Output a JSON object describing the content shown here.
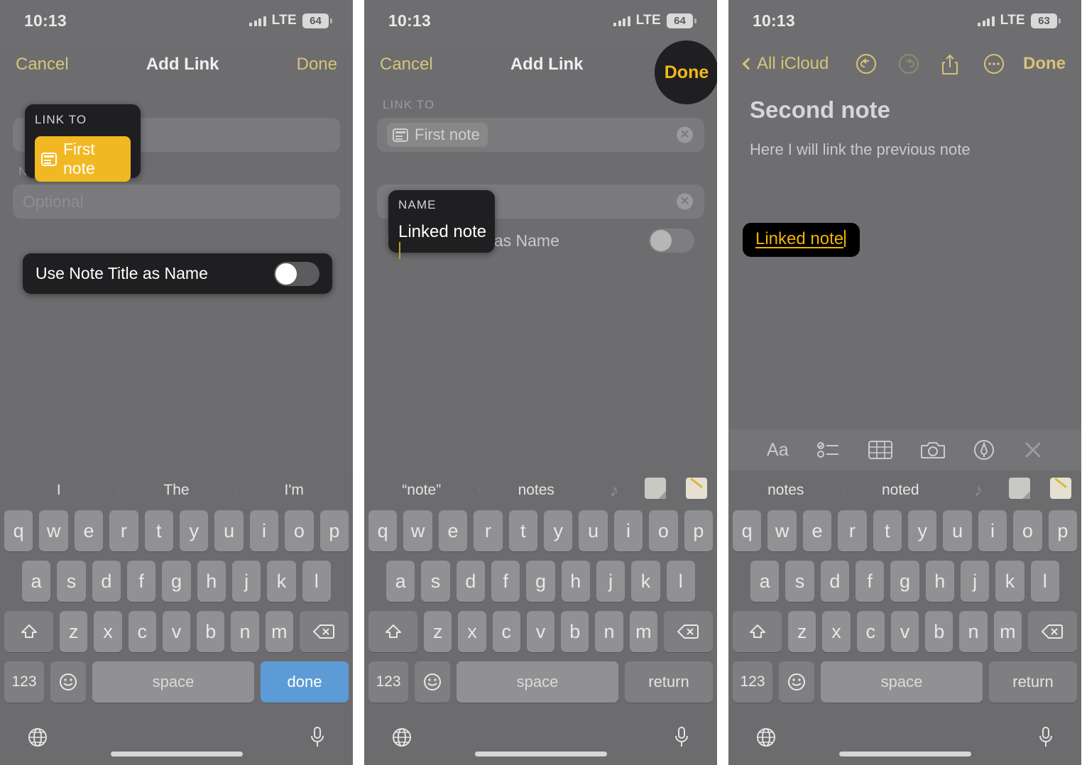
{
  "status": {
    "time": "10:13",
    "carrier": "LTE",
    "battery_1": "64",
    "battery_2": "64",
    "battery_3": "63"
  },
  "panel1": {
    "nav": {
      "cancel": "Cancel",
      "title": "Add Link",
      "done": "Done"
    },
    "link_to_label": "LINK TO",
    "link_chip": "First note",
    "name_label": "NAME",
    "name_placeholder": "Optional",
    "toggle_label": "Use Note Title as Name",
    "predictions": [
      "I",
      "The",
      "I'm"
    ],
    "keys_row1": [
      "q",
      "w",
      "e",
      "r",
      "t",
      "y",
      "u",
      "i",
      "o",
      "p"
    ],
    "keys_row2": [
      "a",
      "s",
      "d",
      "f",
      "g",
      "h",
      "j",
      "k",
      "l"
    ],
    "keys_row3": [
      "z",
      "x",
      "c",
      "v",
      "b",
      "n",
      "m"
    ],
    "num_key": "123",
    "space_key": "space",
    "action_key": "done"
  },
  "panel2": {
    "nav": {
      "cancel": "Cancel",
      "title": "Add Link",
      "done": "Done"
    },
    "link_to_label": "LINK TO",
    "link_chip": "First note",
    "name_label": "NAME",
    "name_value": "Linked note",
    "toggle_label": "Use Note Title as Name",
    "predictions": [
      "“note”",
      "notes"
    ],
    "keys_row1": [
      "q",
      "w",
      "e",
      "r",
      "t",
      "y",
      "u",
      "i",
      "o",
      "p"
    ],
    "keys_row2": [
      "a",
      "s",
      "d",
      "f",
      "g",
      "h",
      "j",
      "k",
      "l"
    ],
    "keys_row3": [
      "z",
      "x",
      "c",
      "v",
      "b",
      "n",
      "m"
    ],
    "num_key": "123",
    "space_key": "space",
    "action_key": "return"
  },
  "panel3": {
    "nav": {
      "back": "All iCloud",
      "done": "Done"
    },
    "note_title": "Second note",
    "note_body": "Here I will link the previous note",
    "link_text": "Linked note",
    "predictions": [
      "notes",
      "noted"
    ],
    "keys_row1": [
      "q",
      "w",
      "e",
      "r",
      "t",
      "y",
      "u",
      "i",
      "o",
      "p"
    ],
    "keys_row2": [
      "a",
      "s",
      "d",
      "f",
      "g",
      "h",
      "j",
      "k",
      "l"
    ],
    "keys_row3": [
      "z",
      "x",
      "c",
      "v",
      "b",
      "n",
      "m"
    ],
    "num_key": "123",
    "space_key": "space",
    "action_key": "return",
    "format_tools": [
      "Aa",
      "checklist",
      "table",
      "camera",
      "markup",
      "close"
    ]
  },
  "colors": {
    "accent_yellow": "#f2b824",
    "nav_tint": "#d8c377",
    "sheet_bg": "#6d6d6f",
    "callout_bg": "#1f1f21",
    "key_bg": "#919193",
    "action_blue": "#5d9bd6"
  }
}
